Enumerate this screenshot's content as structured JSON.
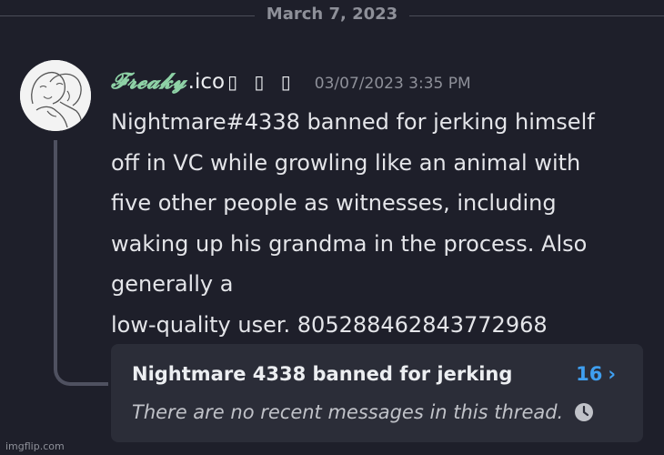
{
  "date_divider": {
    "label": "March 7, 2023"
  },
  "message": {
    "username_fancy": "𝓕𝓻𝓮𝓪𝓴𝔂",
    "username_rest": ".ico",
    "username_glyphs": "▯ ▯ ▯",
    "timestamp": "03/07/2023 3:35 PM",
    "avatar_icon": "sketch-avatar",
    "lines": [
      "Nightmare#4338 banned for jerking himself",
      "off in VC while growling like an animal with",
      "five other people as witnesses, including",
      "waking up his grandma in the process. Also",
      "generally a",
      "low-quality user. 805288462843772968"
    ]
  },
  "thread": {
    "title": "Nightmare 4338 banned for jerking",
    "count": "16",
    "chevron": "›",
    "empty_text": "There are no recent messages in this thread.",
    "clock_icon": "clock-icon"
  },
  "watermark": "imgflip.com",
  "colors": {
    "background": "#1e1f2a",
    "card": "#2b2d38",
    "accent": "#3f9ff0",
    "username": "#8ed2a6"
  }
}
